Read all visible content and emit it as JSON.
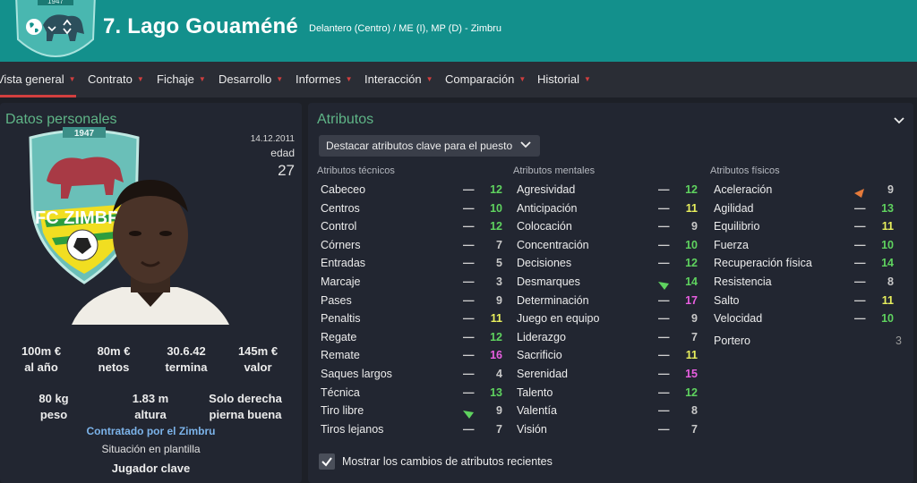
{
  "header": {
    "player_name": "7. Lago Gouaméné",
    "subtitle": "Delantero (Centro) / ME (I), MP (D) - Zimbru",
    "crest_year": "1947"
  },
  "tabs": [
    {
      "label": "Vista general",
      "active": true
    },
    {
      "label": "Contrato"
    },
    {
      "label": "Fichaje"
    },
    {
      "label": "Desarrollo"
    },
    {
      "label": "Informes"
    },
    {
      "label": "Interacción"
    },
    {
      "label": "Comparación"
    },
    {
      "label": "Historial"
    }
  ],
  "personal": {
    "title": "Datos personales",
    "birth_date": "14.12.2011",
    "age_label": "edad",
    "age": "27",
    "crest_year": "1947",
    "crest_text": "FC ZIMBRU",
    "stats_row1": [
      {
        "value": "100m €",
        "label": "al año"
      },
      {
        "value": "80m €",
        "label": "netos"
      },
      {
        "value": "30.6.42",
        "label": "termina"
      },
      {
        "value": "145m €",
        "label": "valor"
      }
    ],
    "stats_row2": [
      {
        "value": "80 kg",
        "label": "peso"
      },
      {
        "value": "1.83 m",
        "label": "altura"
      },
      {
        "value": "Solo derecha",
        "label": "pierna buena"
      }
    ],
    "contracted_by": "Contratado por el Zimbru",
    "squad_status_label": "Situación en plantilla",
    "squad_status": "Jugador clave"
  },
  "attributes": {
    "title": "Atributos",
    "filter_label": "Destacar atributos clave para el puesto",
    "technical": {
      "header": "Atributos técnicos",
      "items": [
        {
          "name": "Cabeceo",
          "value": "12",
          "color": "#5fd35f"
        },
        {
          "name": "Centros",
          "value": "10",
          "color": "#5fd35f"
        },
        {
          "name": "Control",
          "value": "12",
          "color": "#5fd35f"
        },
        {
          "name": "Córners",
          "value": "7",
          "color": "#c9c9c9"
        },
        {
          "name": "Entradas",
          "value": "5",
          "color": "#c9c9c9"
        },
        {
          "name": "Marcaje",
          "value": "3",
          "color": "#c9c9c9"
        },
        {
          "name": "Pases",
          "value": "9",
          "color": "#c9c9c9"
        },
        {
          "name": "Penaltis",
          "value": "11",
          "color": "#e8ef5d"
        },
        {
          "name": "Regate",
          "value": "12",
          "color": "#5fd35f"
        },
        {
          "name": "Remate",
          "value": "16",
          "color": "#e85ee0"
        },
        {
          "name": "Saques largos",
          "value": "4",
          "color": "#c9c9c9"
        },
        {
          "name": "Técnica",
          "value": "13",
          "color": "#5fd35f"
        },
        {
          "name": "Tiro libre",
          "value": "9",
          "color": "#c9c9c9",
          "trend": "up"
        },
        {
          "name": "Tiros lejanos",
          "value": "7",
          "color": "#c9c9c9"
        }
      ]
    },
    "mental": {
      "header": "Atributos mentales",
      "items": [
        {
          "name": "Agresividad",
          "value": "12",
          "color": "#5fd35f"
        },
        {
          "name": "Anticipación",
          "value": "11",
          "color": "#e8ef5d"
        },
        {
          "name": "Colocación",
          "value": "9",
          "color": "#c9c9c9"
        },
        {
          "name": "Concentración",
          "value": "10",
          "color": "#5fd35f"
        },
        {
          "name": "Decisiones",
          "value": "12",
          "color": "#5fd35f"
        },
        {
          "name": "Desmarques",
          "value": "14",
          "color": "#5fd35f",
          "trend": "up"
        },
        {
          "name": "Determinación",
          "value": "17",
          "color": "#e85ee0"
        },
        {
          "name": "Juego en equipo",
          "value": "9",
          "color": "#c9c9c9"
        },
        {
          "name": "Liderazgo",
          "value": "7",
          "color": "#c9c9c9"
        },
        {
          "name": "Sacrificio",
          "value": "11",
          "color": "#e8ef5d"
        },
        {
          "name": "Serenidad",
          "value": "15",
          "color": "#e85ee0"
        },
        {
          "name": "Talento",
          "value": "12",
          "color": "#5fd35f"
        },
        {
          "name": "Valentía",
          "value": "8",
          "color": "#c9c9c9"
        },
        {
          "name": "Visión",
          "value": "7",
          "color": "#c9c9c9"
        }
      ]
    },
    "physical": {
      "header": "Atributos físicos",
      "items": [
        {
          "name": "Aceleración",
          "value": "9",
          "color": "#c9c9c9",
          "trend": "down"
        },
        {
          "name": "Agilidad",
          "value": "13",
          "color": "#5fd35f"
        },
        {
          "name": "Equilibrio",
          "value": "11",
          "color": "#e8ef5d"
        },
        {
          "name": "Fuerza",
          "value": "10",
          "color": "#5fd35f"
        },
        {
          "name": "Recuperación física",
          "value": "14",
          "color": "#5fd35f"
        },
        {
          "name": "Resistencia",
          "value": "8",
          "color": "#c9c9c9"
        },
        {
          "name": "Salto",
          "value": "11",
          "color": "#e8ef5d"
        },
        {
          "name": "Velocidad",
          "value": "10",
          "color": "#5fd35f"
        }
      ],
      "extra": {
        "name": "Portero",
        "value": "3"
      }
    },
    "show_changes_label": "Mostrar los cambios de atributos recientes"
  }
}
